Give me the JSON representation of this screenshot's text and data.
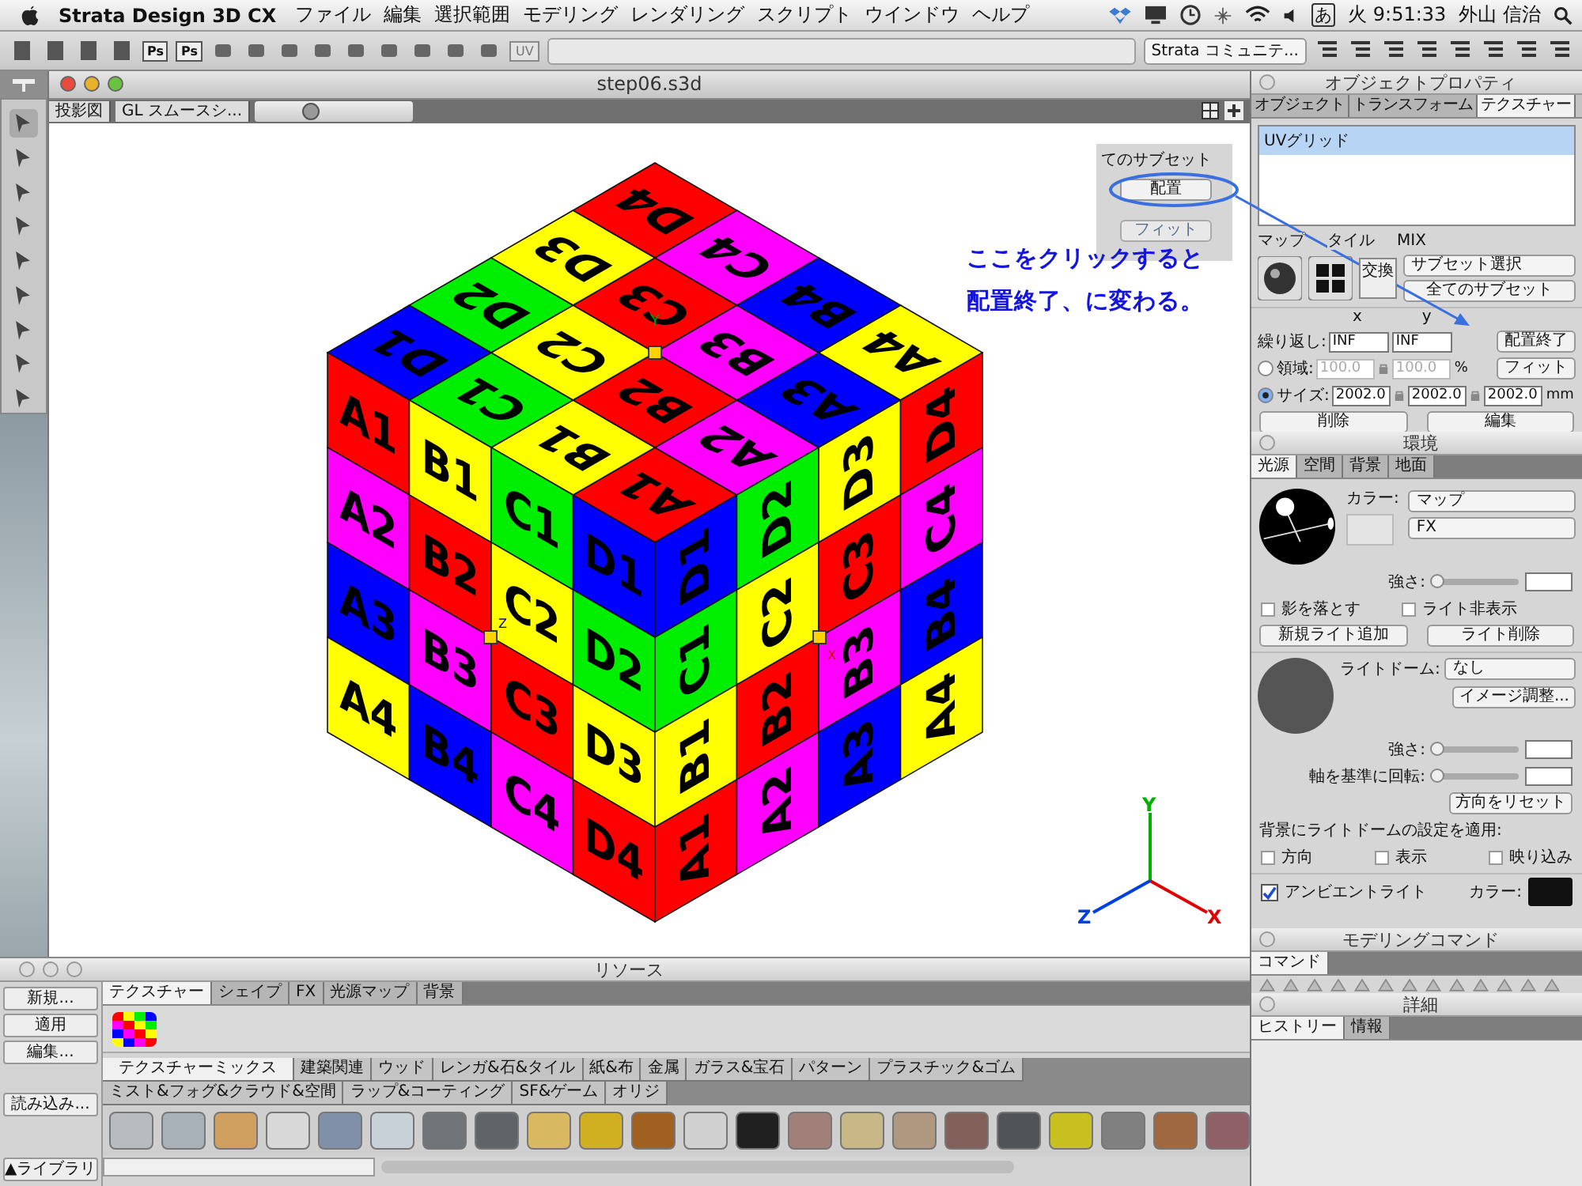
{
  "menu_bar": {
    "app_name": "Strata Design 3D CX",
    "menus": [
      "ファイル",
      "編集",
      "選択範囲",
      "モデリング",
      "レンダリング",
      "スクリプト",
      "ウインドウ",
      "ヘルプ"
    ],
    "input_mode": "あ",
    "clock": "火 9:51:33",
    "user": "外山 信治"
  },
  "toolbar": {
    "ps_labels": [
      "Ps",
      "Ps"
    ],
    "uv_label": "UV",
    "community": "Strata コミュニテ..."
  },
  "viewport": {
    "title": "step06.s3d",
    "projection": "投影図",
    "render_mode": "GL スムースシ...",
    "zoom_slider": {
      "level": 0.35
    },
    "cube": {
      "faces": [
        {
          "kind": "top",
          "tiles": [
            [
              {
                "label": "A1",
                "color": "#ff0000"
              },
              {
                "label": "B1",
                "color": "#ffff00"
              },
              {
                "label": "C1",
                "color": "#00ee00"
              },
              {
                "label": "D1",
                "color": "#0000ff"
              }
            ],
            [
              {
                "label": "A2",
                "color": "#ff00ff"
              },
              {
                "label": "B2",
                "color": "#ff0000"
              },
              {
                "label": "C2",
                "color": "#ffff00"
              },
              {
                "label": "D2",
                "color": "#00ee00"
              }
            ],
            [
              {
                "label": "A3",
                "color": "#0000ff"
              },
              {
                "label": "B3",
                "color": "#ff00ff"
              },
              {
                "label": "C3",
                "color": "#ff0000"
              },
              {
                "label": "D3",
                "color": "#ffff00"
              }
            ],
            [
              {
                "label": "A4",
                "color": "#ffff00"
              },
              {
                "label": "B4",
                "color": "#0000ff"
              },
              {
                "label": "C4",
                "color": "#ff00ff"
              },
              {
                "label": "D4",
                "color": "#ff0000"
              }
            ]
          ]
        },
        {
          "kind": "left",
          "tiles": [
            [
              {
                "label": "A1",
                "color": "#ff0000"
              },
              {
                "label": "B1",
                "color": "#ffff00"
              },
              {
                "label": "C1",
                "color": "#00ee00"
              },
              {
                "label": "D1",
                "color": "#0000ff"
              }
            ],
            [
              {
                "label": "A2",
                "color": "#ff00ff"
              },
              {
                "label": "B2",
                "color": "#ff0000"
              },
              {
                "label": "C2",
                "color": "#ffff00"
              },
              {
                "label": "D2",
                "color": "#00ee00"
              }
            ],
            [
              {
                "label": "A3",
                "color": "#0000ff"
              },
              {
                "label": "B3",
                "color": "#ff00ff"
              },
              {
                "label": "C3",
                "color": "#ff0000"
              },
              {
                "label": "D3",
                "color": "#ffff00"
              }
            ],
            [
              {
                "label": "A4",
                "color": "#ffff00"
              },
              {
                "label": "B4",
                "color": "#0000ff"
              },
              {
                "label": "C4",
                "color": "#ff00ff"
              },
              {
                "label": "D4",
                "color": "#ff0000"
              }
            ]
          ]
        },
        {
          "kind": "right",
          "tiles": [
            [
              {
                "label": "D1",
                "color": "#0000ff"
              },
              {
                "label": "D2",
                "color": "#00ee00"
              },
              {
                "label": "D3",
                "color": "#ffff00"
              },
              {
                "label": "D4",
                "color": "#ff0000"
              }
            ],
            [
              {
                "label": "C1",
                "color": "#00ee00"
              },
              {
                "label": "C2",
                "color": "#ffff00"
              },
              {
                "label": "C3",
                "color": "#ff0000"
              },
              {
                "label": "C4",
                "color": "#ff00ff"
              }
            ],
            [
              {
                "label": "B1",
                "color": "#ffff00"
              },
              {
                "label": "B2",
                "color": "#ff0000"
              },
              {
                "label": "B3",
                "color": "#ff00ff"
              },
              {
                "label": "B4",
                "color": "#0000ff"
              }
            ],
            [
              {
                "label": "A1",
                "color": "#ff0000"
              },
              {
                "label": "A2",
                "color": "#ff00ff"
              },
              {
                "label": "A3",
                "color": "#0000ff"
              },
              {
                "label": "A4",
                "color": "#ffff00"
              }
            ]
          ]
        }
      ]
    },
    "handle_labels": {
      "y": "Y",
      "z": "Z",
      "x": "X"
    },
    "axis_labels": {
      "y": "Y",
      "z": "Z",
      "x": "X"
    },
    "inset": {
      "caption": "てのサブセット",
      "button": "配置",
      "hidden_button": "フィット"
    },
    "annotation": [
      "ここをクリックすると",
      "配置終了、に変わる。"
    ]
  },
  "object_properties": {
    "title": "オブジェクトプロパティ",
    "tabs": [
      {
        "label": "オブジェクト",
        "selected": false
      },
      {
        "label": "トランスフォーム",
        "selected": false
      },
      {
        "label": "テクスチャー",
        "selected": true
      }
    ],
    "textures": [
      {
        "name": "UVグリッド",
        "selected": true
      }
    ],
    "slot_labels": [
      "マップ",
      "タイル",
      "MIX"
    ],
    "swap_button": "交換",
    "subset_dropdown": "サブセット選択",
    "all_subsets_button": "全てのサブセット",
    "col_x": "x",
    "col_y": "y",
    "repeat_label": "繰り返し:",
    "repeat_x": "INF",
    "repeat_y": "INF",
    "place_button": "配置終了",
    "modes": [
      {
        "label": "領域:",
        "selected": false,
        "values": [
          "100.0",
          "100.0"
        ],
        "unit": "%",
        "button": "フィット"
      },
      {
        "label": "サイズ:",
        "selected": true,
        "values": [
          "2002.0",
          "2002.0",
          "2002.0"
        ],
        "unit": "mm"
      }
    ],
    "delete_button": "削除",
    "edit_button": "編集"
  },
  "environment": {
    "title": "環境",
    "tabs": [
      {
        "label": "光源",
        "selected": true
      },
      {
        "label": "空間",
        "selected": false
      },
      {
        "label": "背景",
        "selected": false
      },
      {
        "label": "地面",
        "selected": false
      }
    ],
    "color_label": "カラー:",
    "map_dropdown": "マップ",
    "fx_dropdown": "FX",
    "strength_label": "強さ:",
    "strength_slider": {
      "level": 0.05
    },
    "cast_shadow": {
      "label": "影を落とす",
      "checked": false
    },
    "hide_light": {
      "label": "ライト非表示",
      "checked": false
    },
    "add_light_button": "新規ライト追加",
    "delete_light_button": "ライト削除",
    "dome_label": "ライトドーム:",
    "dome_dropdown": "なし",
    "image_adjust_button": "イメージ調整...",
    "dome_strength_label": "強さ:",
    "dome_strength_slider": {
      "level": 0.05
    },
    "rotate_label": "軸を基準に回転:",
    "rotate_slider": {
      "level": 0.05
    },
    "reset_button": "方向をリセット",
    "apply_label": "背景にライトドームの設定を適用:",
    "apply_options": [
      {
        "label": "方向",
        "checked": false
      },
      {
        "label": "表示",
        "checked": false
      },
      {
        "label": "映り込み",
        "checked": false
      }
    ],
    "ambient": {
      "label": "アンビエントライト",
      "checked": true
    },
    "ambient_color_label": "カラー:"
  },
  "modeling_commands": {
    "title": "モデリングコマンド",
    "tab": "コマンド"
  },
  "details": {
    "title": "詳細",
    "tabs": [
      {
        "label": "ヒストリー",
        "selected": true
      },
      {
        "label": "情報",
        "selected": false
      }
    ]
  },
  "resources": {
    "title": "リソース",
    "new_button": "新規...",
    "apply_button": "適用",
    "edit_button": "編集...",
    "load_button": "読み込み...",
    "library_button": "▲ライブラリ",
    "tabs": [
      {
        "label": "テクスチャー",
        "selected": true
      },
      {
        "label": "シェイプ",
        "selected": false
      },
      {
        "label": "FX",
        "selected": false
      },
      {
        "label": "光源マップ",
        "selected": false
      },
      {
        "label": "背景",
        "selected": false
      }
    ],
    "categories": [
      {
        "label": "テクスチャーミックス",
        "selected": true
      },
      {
        "label": "建築関連",
        "selected": false
      },
      {
        "label": "ウッド",
        "selected": false
      },
      {
        "label": "レンガ&石&タイル",
        "selected": false
      },
      {
        "label": "紙&布",
        "selected": false
      },
      {
        "label": "金属",
        "selected": false
      },
      {
        "label": "ガラス&宝石",
        "selected": false
      },
      {
        "label": "パターン",
        "selected": false
      },
      {
        "label": "プラスチック&ゴム",
        "selected": false
      },
      {
        "label": "ミスト&フォグ&クラウド&空間",
        "selected": false
      },
      {
        "label": "ラップ&コーティング",
        "selected": false
      },
      {
        "label": "SF&ゲーム",
        "selected": false
      },
      {
        "label": "オリジ",
        "selected": false
      }
    ],
    "materials": [
      {
        "color": "#b8bcc0"
      },
      {
        "color": "#a8b0b8"
      },
      {
        "color": "#d0a060"
      },
      {
        "color": "#d8d8d8"
      },
      {
        "color": "#8090a8"
      },
      {
        "color": "#c8d0d8"
      },
      {
        "color": "#707478"
      },
      {
        "color": "#606468"
      },
      {
        "color": "#d8b860"
      },
      {
        "color": "#d0b020"
      },
      {
        "color": "#a06020"
      },
      {
        "color": "#d0d0d0"
      },
      {
        "color": "#202020"
      },
      {
        "color": "#a08078"
      },
      {
        "color": "#c8b888"
      },
      {
        "color": "#b09880"
      },
      {
        "color": "#806058"
      },
      {
        "color": "#505458"
      },
      {
        "color": "#c8c020"
      },
      {
        "color": "#808080"
      },
      {
        "color": "#a06840"
      },
      {
        "color": "#906068"
      }
    ]
  }
}
